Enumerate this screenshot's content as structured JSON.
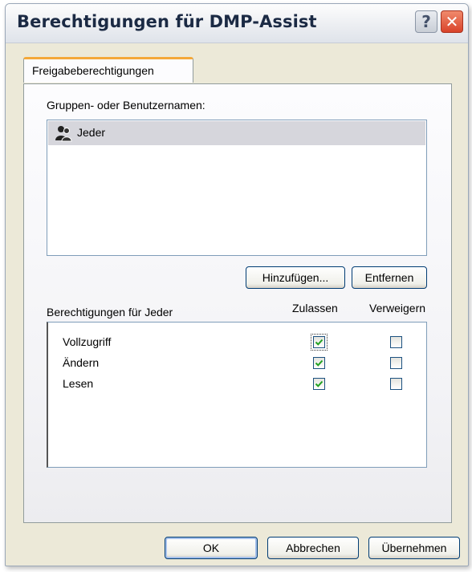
{
  "window": {
    "title": "Berechtigungen für DMP-Assist",
    "help_glyph": "?",
    "close_glyph": "✕"
  },
  "tabs": [
    {
      "label": "Freigabeberechtigungen",
      "selected": true
    }
  ],
  "groups": {
    "label": "Gruppen- oder Benutzernamen:",
    "items": [
      {
        "name": "Jeder",
        "icon": "users-group-icon",
        "selected": true
      }
    ],
    "add_button": "Hinzufügen...",
    "remove_button": "Entfernen"
  },
  "permissions": {
    "label": "Berechtigungen für Jeder",
    "col_allow": "Zulassen",
    "col_deny": "Verweigern",
    "rows": [
      {
        "name": "Vollzugriff",
        "allow": true,
        "deny": false
      },
      {
        "name": "Ändern",
        "allow": true,
        "deny": false
      },
      {
        "name": "Lesen",
        "allow": true,
        "deny": false
      }
    ]
  },
  "footer": {
    "ok": "OK",
    "cancel": "Abbrechen",
    "apply": "Übernehmen"
  },
  "colors": {
    "check": "#21a121",
    "tab_accent": "#f4a839"
  }
}
